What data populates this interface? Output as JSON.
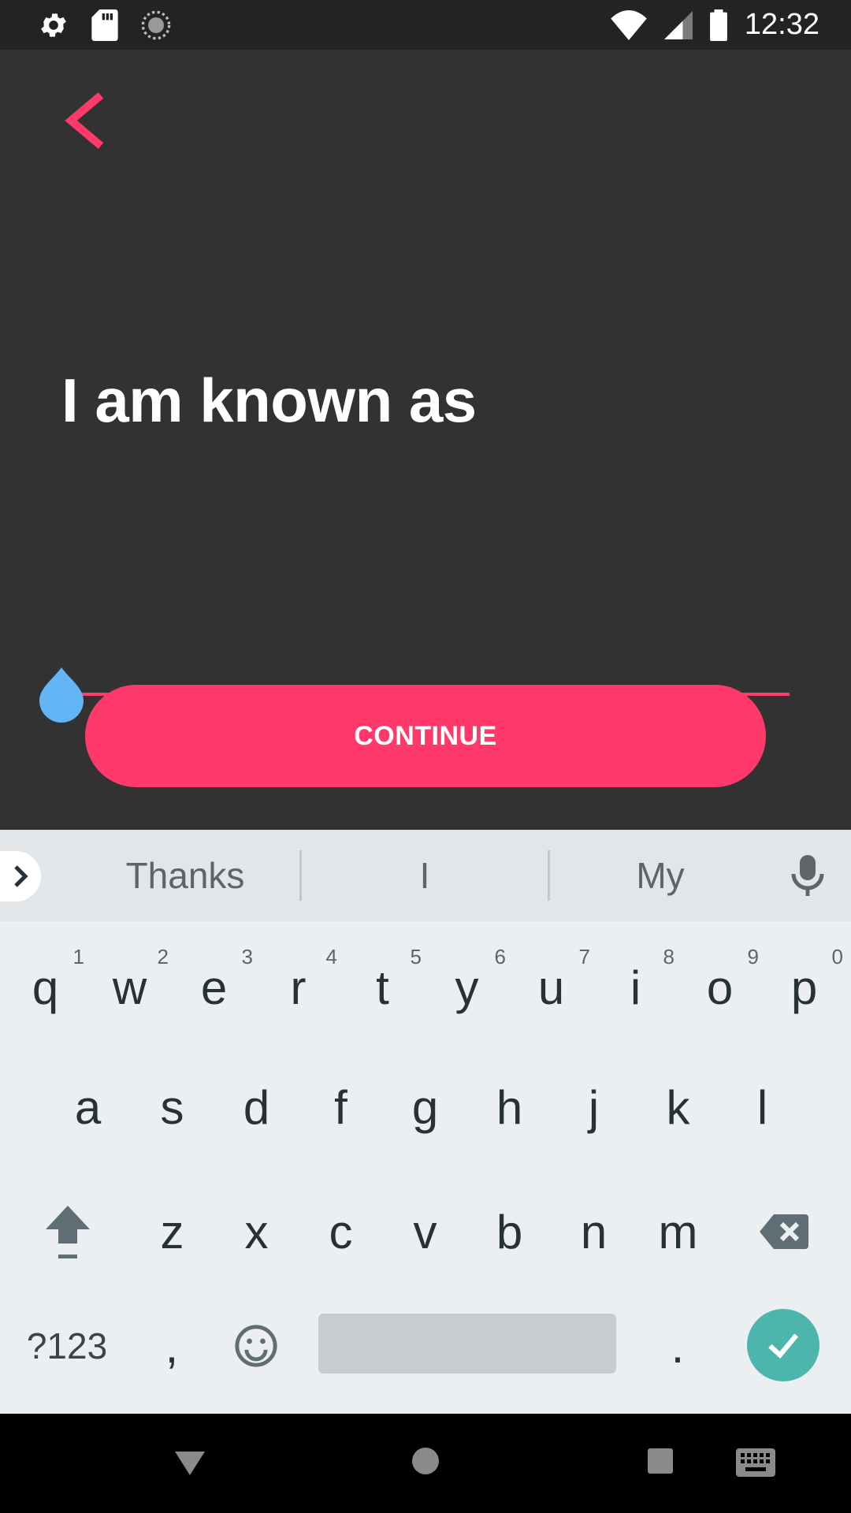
{
  "status_bar": {
    "time": "12:32",
    "left_icons": [
      "settings-icon",
      "sd-card-icon",
      "sync-icon"
    ],
    "right_icons": [
      "wifi-icon",
      "signal-icon",
      "battery-icon"
    ]
  },
  "screen": {
    "prompt": "I am known as",
    "name_value": "",
    "continue_label": "CONTINUE",
    "accent_color": "#ff3a6a",
    "background_color": "#323232"
  },
  "keyboard": {
    "suggestions": [
      "Thanks",
      "I",
      "My"
    ],
    "row1": [
      {
        "key": "q",
        "hint": "1"
      },
      {
        "key": "w",
        "hint": "2"
      },
      {
        "key": "e",
        "hint": "3"
      },
      {
        "key": "r",
        "hint": "4"
      },
      {
        "key": "t",
        "hint": "5"
      },
      {
        "key": "y",
        "hint": "6"
      },
      {
        "key": "u",
        "hint": "7"
      },
      {
        "key": "i",
        "hint": "8"
      },
      {
        "key": "o",
        "hint": "9"
      },
      {
        "key": "p",
        "hint": "0"
      }
    ],
    "row2": [
      "a",
      "s",
      "d",
      "f",
      "g",
      "h",
      "j",
      "k",
      "l"
    ],
    "row3": [
      "z",
      "x",
      "c",
      "v",
      "b",
      "n",
      "m"
    ],
    "symbols_label": "?123",
    "comma": ",",
    "period": ".",
    "enter_color": "#4db6ac"
  },
  "nav_bar": {
    "buttons": [
      "back-icon",
      "home-icon",
      "recents-icon",
      "keyboard-switch-icon"
    ]
  }
}
